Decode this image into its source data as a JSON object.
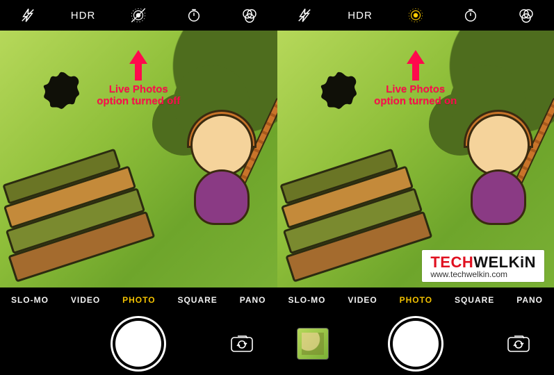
{
  "topbar": {
    "hdr_label": "HDR"
  },
  "modes": {
    "slomo": "SLO-MO",
    "video": "VIDEO",
    "photo": "PHOTO",
    "square": "SQUARE",
    "pano": "PANO",
    "active": "photo"
  },
  "annotations": {
    "left": {
      "line1": "Live Photos",
      "line2": "option turned off"
    },
    "right": {
      "line1": "Live Photos",
      "line2": "option turned on"
    }
  },
  "live_photos": {
    "left_state": "off",
    "right_state": "on",
    "off_color": "#ffffff",
    "on_color": "#ffcc00"
  },
  "watermark": {
    "brand_part1": "TECH",
    "brand_part2": "WELKiN",
    "url": "www.techwelkin.com"
  }
}
